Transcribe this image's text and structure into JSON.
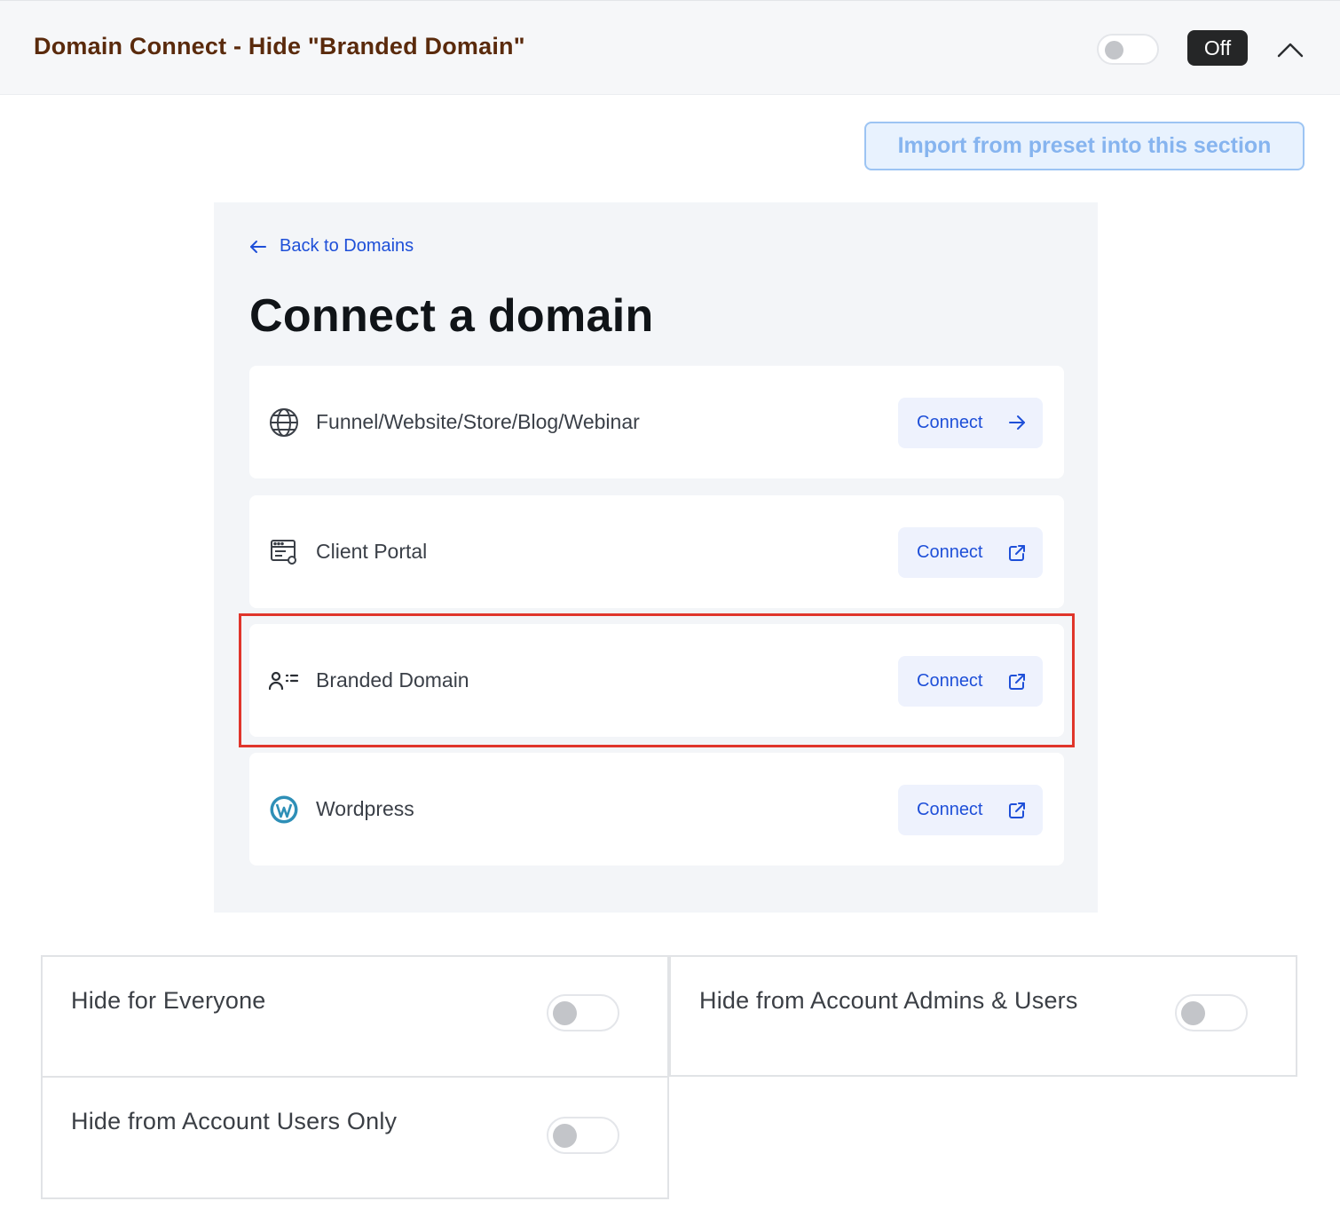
{
  "header": {
    "title": "Domain Connect - Hide \"Branded Domain\"",
    "toggle_state": "off",
    "status_badge": "Off"
  },
  "import_button": {
    "label": "Import from preset into this section"
  },
  "panel": {
    "back_link": "Back to Domains",
    "title": "Connect a domain",
    "rows": [
      {
        "label": "Funnel/Website/Store/Blog/Webinar",
        "icon": "globe-icon",
        "button": "Connect",
        "button_icon": "arrow-right-icon"
      },
      {
        "label": "Client Portal",
        "icon": "client-portal-icon",
        "button": "Connect",
        "button_icon": "external-link-icon"
      },
      {
        "label": "Branded Domain",
        "icon": "user-list-icon",
        "button": "Connect",
        "button_icon": "external-link-icon",
        "highlighted": true
      },
      {
        "label": "Wordpress",
        "icon": "wordpress-icon",
        "button": "Connect",
        "button_icon": "external-link-icon"
      }
    ]
  },
  "options": [
    {
      "label": "Hide for Everyone",
      "enabled": false
    },
    {
      "label": "Hide from Account Admins & Users",
      "enabled": false
    },
    {
      "label": "Hide from Account Users Only",
      "enabled": false
    }
  ],
  "colors": {
    "header_title": "#5a2a0c",
    "link_blue": "#1e4fd8",
    "highlight_red": "#e0352b",
    "import_text": "#86b4ef"
  }
}
